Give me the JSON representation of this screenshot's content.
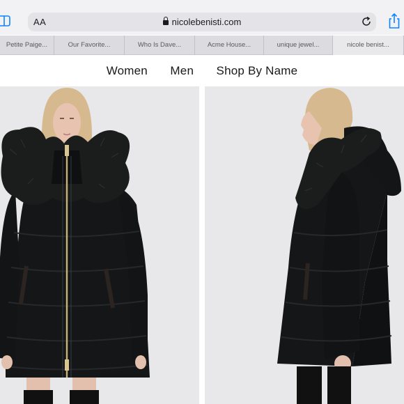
{
  "browser": {
    "text_size_label": "AA",
    "url": "nicolebenisti.com"
  },
  "tabs": [
    {
      "label": "Petite Paige..."
    },
    {
      "label": "Our Favorite..."
    },
    {
      "label": "Who Is Dave..."
    },
    {
      "label": "Acme House..."
    },
    {
      "label": "unique jewel..."
    },
    {
      "label": "nicole benist..."
    }
  ],
  "nav": {
    "women": "Women",
    "men": "Men",
    "shop_by_name": "Shop By Name"
  },
  "products": {
    "front_image": "black-puffer-coat-front",
    "side_image": "black-puffer-coat-side"
  },
  "colors": {
    "coat": "#151618",
    "fur": "#1b1d1c",
    "background": "#e8e8ea",
    "zipper": "#c9b27a",
    "skin": "#e8c4b0",
    "hair": "#d6b98f"
  }
}
